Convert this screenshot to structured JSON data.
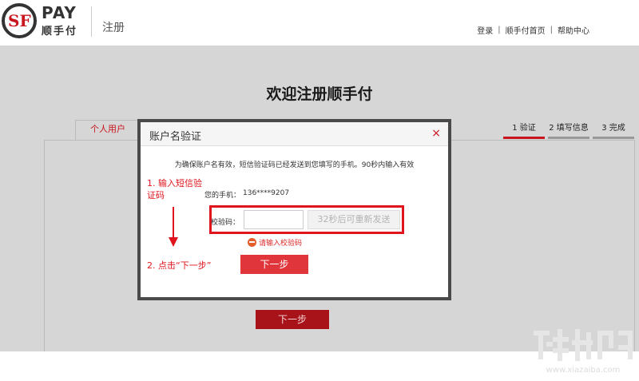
{
  "header": {
    "logo_mark": "SF",
    "logo_pay": "PAY",
    "logo_cn": "顺手付",
    "title": "注册",
    "nav": [
      "登录",
      "顺手付首页",
      "帮助中心"
    ],
    "nav_separator": "|"
  },
  "page": {
    "title": "欢迎注册顺手付",
    "tab_label": "个人用户",
    "steps": [
      "1 验证",
      "2 填写信息",
      "3 完成"
    ],
    "active_step": 0,
    "next_label": "下一步"
  },
  "modal": {
    "title": "账户名验证",
    "close_icon": "×",
    "info": "为确保账户名有效，短信验证码已经发送到您填写的手机。90秒内输入有效",
    "phone_label": "您的手机：",
    "phone_value": "136****9207",
    "code_label": "校验码：",
    "code_value": "",
    "resend_label": "32秒后可重新发送",
    "error_text": "请输入校验码",
    "next_label": "下一步"
  },
  "annotations": {
    "step1": "1. 输入短信验证码",
    "step2": "2. 点击“下一步”"
  },
  "colors": {
    "accent": "#e0141d",
    "overlay_bg": "#d6d6d6",
    "button_red": "#e0353b"
  },
  "watermark": {
    "text": "www.xiazaiba.com"
  }
}
